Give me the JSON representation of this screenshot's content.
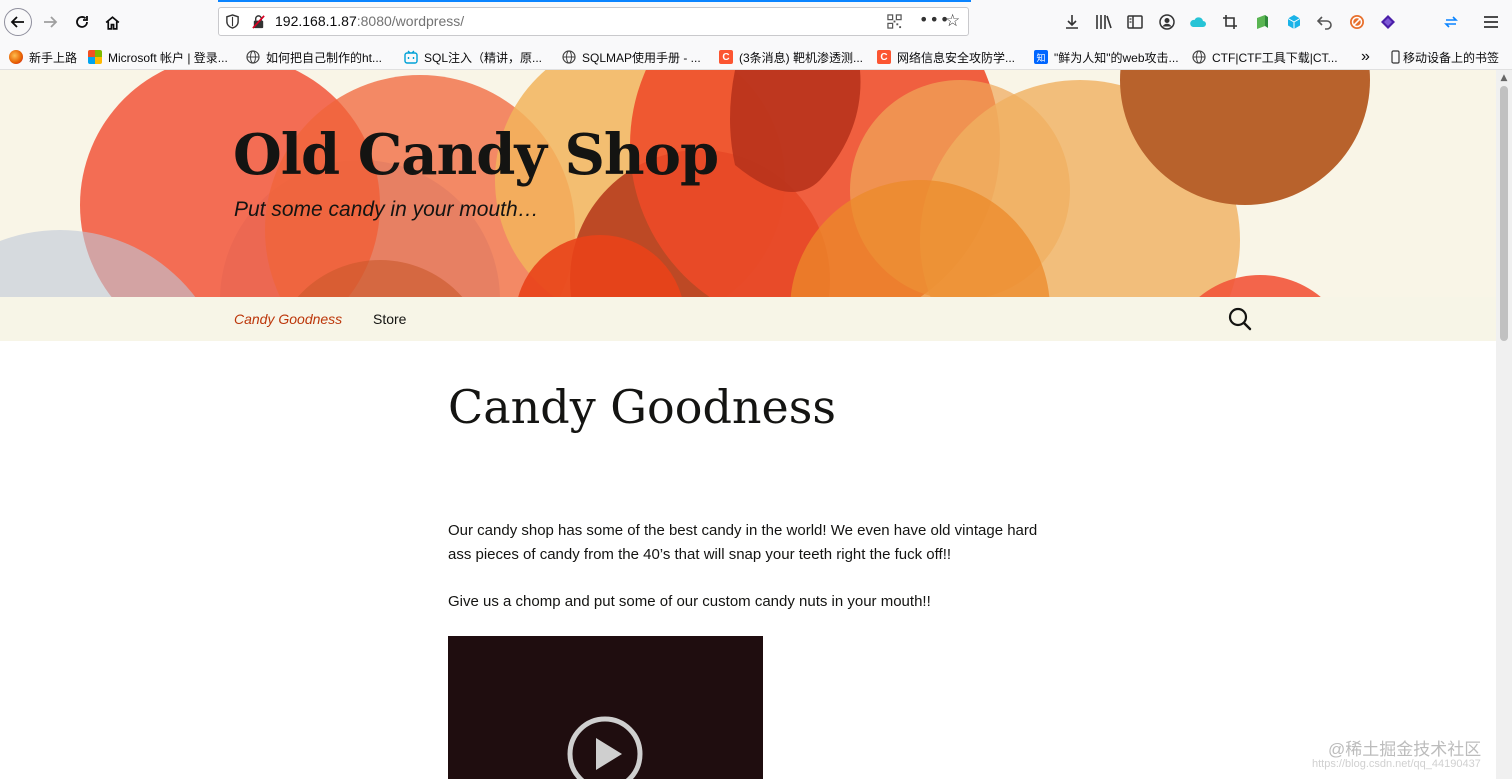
{
  "browser": {
    "url_host": "192.168.1.87",
    "url_rest": ":8080/wordpress/",
    "bookmarks": [
      {
        "label": "新手上路",
        "icon": "firefox-icon",
        "color": "#e66000"
      },
      {
        "label": "Microsoft 帐户 | 登录...",
        "icon": "microsoft-icon",
        "color": "#00a4ef"
      },
      {
        "label": "如何把自己制作的ht...",
        "icon": "globe-icon",
        "color": "#555555"
      },
      {
        "label": "SQL注入（精讲，原...",
        "icon": "bilibili-icon",
        "color": "#00a1d6"
      },
      {
        "label": "SQLMAP使用手册 - ...",
        "icon": "globe-icon",
        "color": "#555555"
      },
      {
        "label": "(3条消息) 靶机渗透测...",
        "icon": "csdn-icon",
        "color": "#fc5531"
      },
      {
        "label": "网络信息安全攻防学...",
        "icon": "csdn-icon",
        "color": "#fc5531"
      },
      {
        "label": "\"鲜为人知\"的web攻击...",
        "icon": "zhihu-icon",
        "color": "#0066ff"
      },
      {
        "label": "CTF|CTF工具下载|CT...",
        "icon": "globe-icon",
        "color": "#555555"
      }
    ],
    "overflow_label": "»",
    "mobile_bookmarks": "移动设备上的书签"
  },
  "site": {
    "title": "Old Candy Shop",
    "description": "Put some candy in your mouth…",
    "nav": {
      "current": "Candy Goodness",
      "store": "Store"
    }
  },
  "post": {
    "title": "Candy Goodness",
    "paragraph1": "Our candy shop has some of the best candy in the world! We even have old vintage hard ass pieces of candy from the 40’s that will snap your teeth right the fuck off!!",
    "paragraph2": "Give us a chomp and put some of our custom candy nuts in your mouth!!"
  },
  "watermark": {
    "text": "@稀土掘金技术社区",
    "subtext": "https://blog.csdn.net/qq_44190437"
  },
  "colors": {
    "accent": "#bc360a",
    "header_bg": "#f9f5e7",
    "video_bg": "#1f0d0f"
  }
}
